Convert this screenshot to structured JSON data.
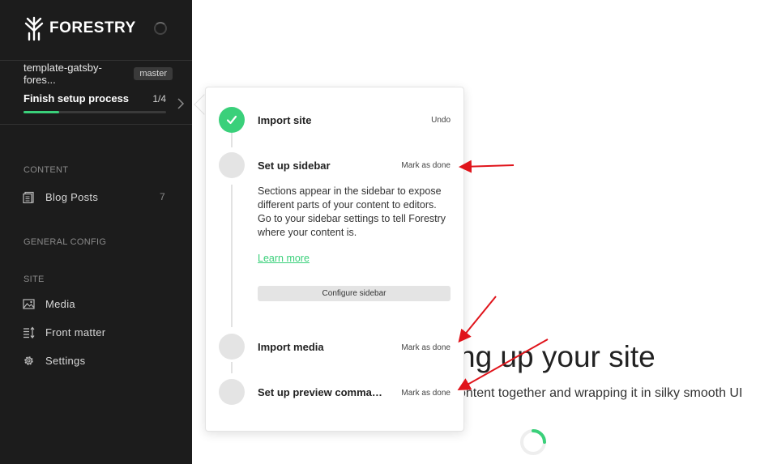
{
  "sidebar": {
    "brand": "FORESTRY",
    "repo_name": "template-gatsby-fores...",
    "branch": "master",
    "setup": {
      "label": "Finish setup process",
      "count": "1/4",
      "progress": 0.25
    },
    "sections": {
      "content": "CONTENT",
      "general_config": "GENERAL CONFIG",
      "site": "SITE"
    },
    "content_items": [
      {
        "label": "Blog Posts",
        "count": "7",
        "icon": "document-icon"
      }
    ],
    "site_items": [
      {
        "label": "Media",
        "icon": "image-icon"
      },
      {
        "label": "Front matter",
        "icon": "sort-list-icon"
      },
      {
        "label": "Settings",
        "icon": "gear-icon"
      }
    ]
  },
  "main": {
    "hero_title": "ng up your site",
    "hero_subtitle": "ontent together and wrapping it in silky smooth UI"
  },
  "setup_popover": {
    "steps": [
      {
        "title": "Import site",
        "action": "Undo",
        "done": true
      },
      {
        "title": "Set up sidebar",
        "action": "Mark as done",
        "done": false,
        "description": "Sections appear in the sidebar to expose different parts of your content to editors. Go to your sidebar settings to tell Forestry where your content is.",
        "link": "Learn more",
        "button": "Configure sidebar"
      },
      {
        "title": "Import media",
        "action": "Mark as done",
        "done": false
      },
      {
        "title": "Set up preview comma…",
        "action": "Mark as done",
        "done": false
      }
    ]
  },
  "colors": {
    "sidebar_bg": "#1c1c1c",
    "accent": "#3ad07a",
    "annotation": "#e0141b"
  }
}
